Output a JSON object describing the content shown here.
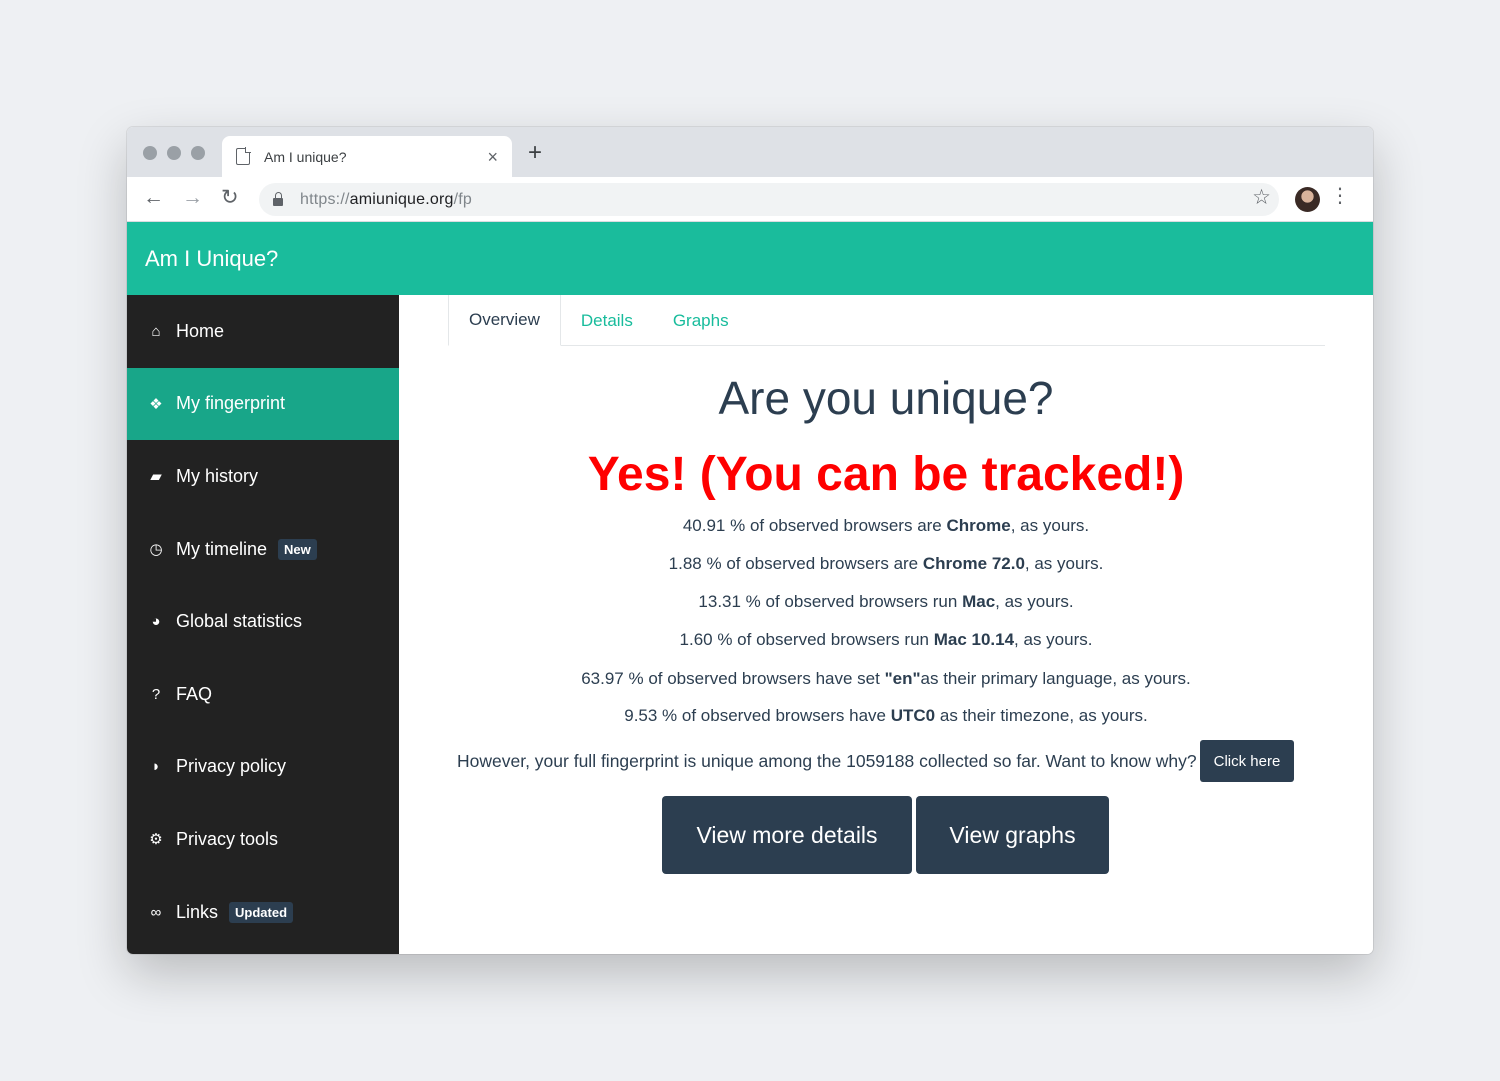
{
  "browser": {
    "tab_title": "Am I unique?",
    "tab_close": "×",
    "new_tab": "+",
    "back": "←",
    "forward": "→",
    "reload": "↻",
    "url_scheme": "https://",
    "url_host": "amiunique.org",
    "url_path": "/fp",
    "star": "☆",
    "menu": "⋮"
  },
  "header": {
    "brand": "Am I Unique?"
  },
  "sidebar": {
    "items": [
      {
        "label": "Home",
        "icon": "home-icon",
        "glyph": "⌂"
      },
      {
        "label": "My fingerprint",
        "icon": "paw-icon",
        "glyph": "❖",
        "active": true
      },
      {
        "label": "My history",
        "icon": "book-icon",
        "glyph": "▰"
      },
      {
        "label": "My timeline",
        "icon": "clock-icon",
        "glyph": "◷",
        "badge": "New"
      },
      {
        "label": "Global statistics",
        "icon": "pie-chart-icon",
        "glyph": "◕"
      },
      {
        "label": "FAQ",
        "icon": "question-icon",
        "glyph": "?"
      },
      {
        "label": "Privacy policy",
        "icon": "shield-icon",
        "glyph": "◗"
      },
      {
        "label": "Privacy tools",
        "icon": "gears-icon",
        "glyph": "⚙"
      },
      {
        "label": "Links",
        "icon": "link-icon",
        "glyph": "∞",
        "badge": "Updated"
      }
    ]
  },
  "main": {
    "tabs": [
      "Overview",
      "Details",
      "Graphs"
    ],
    "headline": "Are you unique?",
    "verdict": "Yes! (You can be tracked!)",
    "stats": [
      {
        "pre": "40.91 % of observed browsers are ",
        "bold": "Chrome",
        "post": ", as yours."
      },
      {
        "pre": "1.88 % of observed browsers are ",
        "bold": "Chrome 72.0",
        "post": ", as yours."
      },
      {
        "pre": "13.31 % of observed browsers run ",
        "bold": "Mac",
        "post": ", as yours."
      },
      {
        "pre": "1.60 % of observed browsers run ",
        "bold": "Mac 10.14",
        "post": ", as yours."
      },
      {
        "pre": "63.97 % of observed browsers have set ",
        "bold": "\"en\"",
        "post": "as their primary language, as yours."
      },
      {
        "pre": "9.53 % of observed browsers have ",
        "bold": "UTC0",
        "post": " as their timezone, as yours."
      }
    ],
    "summary": "However, your full fingerprint is unique among the 1059188 collected so far. Want to know why?",
    "click_here": "Click here",
    "view_details": "View more details",
    "view_graphs": "View graphs"
  },
  "colors": {
    "accent": "#1abc9c",
    "sidebar_bg": "#222222",
    "sidebar_active": "#18a689",
    "primary_dark": "#2c3e50",
    "alert_red": "#ff0000"
  }
}
